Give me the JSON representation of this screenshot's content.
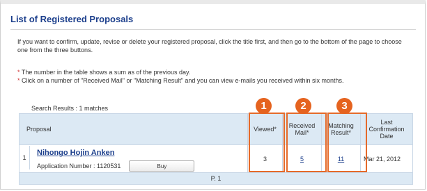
{
  "page_title": "List of Registered Proposals",
  "intro_text": "If you want to confirm, update, revise or delete your registered proposal, click the title first, and then go to the bottom of the page to choose one from the three buttons.",
  "notes": [
    "The number in the table shows a sum as of the previous day.",
    "Click on a number of \"Received Mail\" or \"Matching Result\" and you can view e-mails you received within six months."
  ],
  "note_marker": "*",
  "search_results": "Search Results : 1 matches",
  "table": {
    "headers": {
      "proposal": "Proposal",
      "viewed": "Viewed*",
      "received_mail": "Received Mail*",
      "matching_result": "Matching Result*",
      "last_confirmation": "Last Confirmation Date"
    },
    "rows": [
      {
        "index": "1",
        "title": "Nihongo Hojin Anken",
        "application_number": "Application Number : 1120531",
        "buy_label": "Buy",
        "viewed": "3",
        "received_mail": "5",
        "matching_result": "11",
        "last_confirmation": "Mar 21, 2012"
      }
    ],
    "pager": "P. 1"
  },
  "badges": [
    "1",
    "2",
    "3"
  ],
  "colors": {
    "title": "#1c3f8c",
    "header_bg": "#dce9f4",
    "highlight": "#e56a2a",
    "badge": "#e5631f"
  }
}
